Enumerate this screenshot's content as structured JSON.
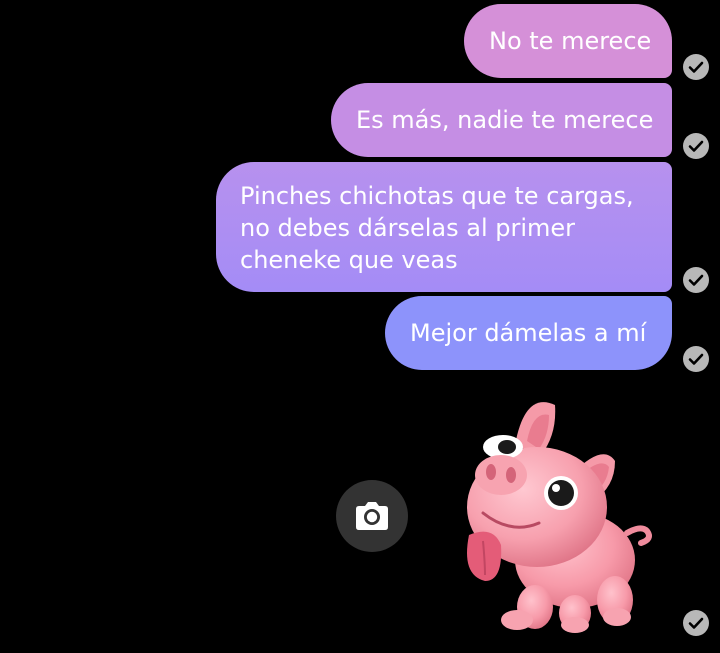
{
  "messages": [
    {
      "lines": [
        "No te merece"
      ],
      "status": "sent"
    },
    {
      "lines": [
        "Es más, nadie te merece"
      ],
      "status": "sent"
    },
    {
      "lines": [
        "Pinches chichotas que te cargas,",
        "no debes dárselas al primer",
        "cheneke que veas"
      ],
      "status": "sent"
    },
    {
      "lines": [
        "Mejor dámelas a mí"
      ],
      "status": "sent"
    }
  ],
  "sticker": {
    "icon": "pig-sticker",
    "status": "sent"
  },
  "camera_button": {
    "icon": "camera-icon"
  },
  "colors": {
    "background": "#000000",
    "bubble_top": "#d590d8",
    "bubble_bottom": "#8d93fb",
    "check": "#b8b8b8",
    "camera_button_bg": "#333333"
  }
}
